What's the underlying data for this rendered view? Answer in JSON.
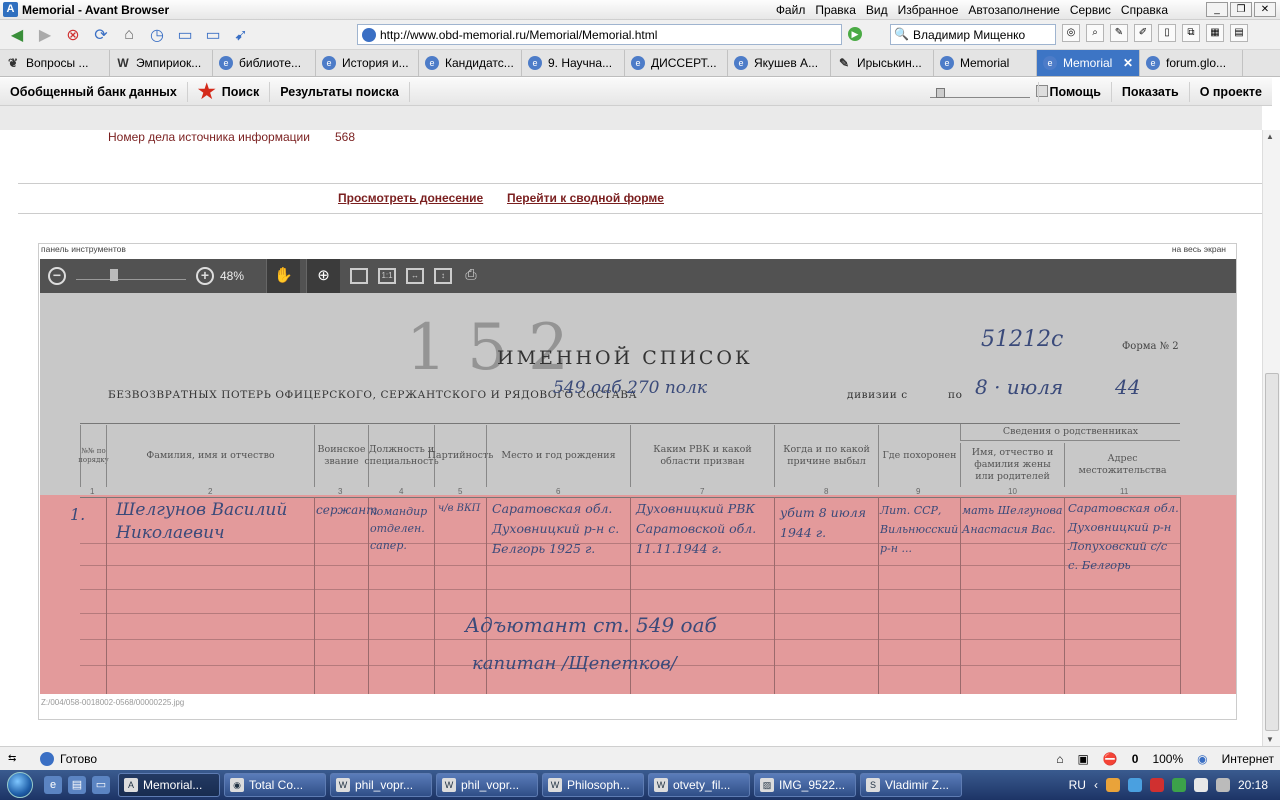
{
  "window": {
    "title": "Memorial - Avant Browser"
  },
  "menu": [
    "Файл",
    "Правка",
    "Вид",
    "Избранное",
    "Автозаполнение",
    "Сервис",
    "Справка"
  ],
  "address": {
    "url": "http://www.obd-memorial.ru/Memorial/Memorial.html"
  },
  "search": {
    "value": "Владимир Мищенко"
  },
  "tabs": [
    {
      "label": "Вопросы ...",
      "icon": "book-icon"
    },
    {
      "label": "Эмпириок...",
      "icon": "wikipedia-icon"
    },
    {
      "label": "библиоте...",
      "icon": "globe-icon"
    },
    {
      "label": "История и...",
      "icon": "globe-icon"
    },
    {
      "label": "Кандидатс...",
      "icon": "globe-icon"
    },
    {
      "label": "9. Научна...",
      "icon": "globe-icon"
    },
    {
      "label": "ДИССЕРТ...",
      "icon": "globe-icon"
    },
    {
      "label": "Якушев А...",
      "icon": "globe-icon"
    },
    {
      "label": "Ирыськин...",
      "icon": "pencil-icon"
    },
    {
      "label": "Memorial",
      "icon": "globe-icon"
    },
    {
      "label": "Memorial",
      "icon": "globe-icon",
      "active": true
    },
    {
      "label": "forum.glo...",
      "icon": "globe-icon"
    }
  ],
  "site_nav": {
    "bank": "Обобщенный банк данных",
    "search": "Поиск",
    "results": "Результаты поиска",
    "help": "Помощь",
    "show": "Показать",
    "about": "О проекте"
  },
  "record": {
    "case_label": "Номер дела источника информации",
    "case_value": "568",
    "link_view": "Просмотреть донесение",
    "link_summary": "Перейти к сводной форме"
  },
  "viewer": {
    "panel_label": "панель инструментов",
    "fullscreen_label": "на весь экран",
    "zoom": "48%",
    "file_path": "Z:/004/058-0018002-0568/00000225.jpg"
  },
  "document": {
    "title": "ИМЕННОЙ СПИСОК",
    "subtitle": "БЕЗВОЗВРАТНЫХ ПОТЕРЬ ОФИЦЕРСКОГО, СЕРЖАНТСКОГО И РЯДОВОГО СОСТАВА",
    "form_number": "Форма № 2",
    "division_label": "дивизии с",
    "by_label": "по",
    "doc_number": "51212с",
    "unit_hw": "549 оаб  270 полк",
    "date_hw": "8 · июля",
    "year_hw": "44",
    "columns": [
      {
        "n": "1",
        "label": "№№ по порядку"
      },
      {
        "n": "2",
        "label": "Фамилия, имя и отчество"
      },
      {
        "n": "3",
        "label": "Воинское звание"
      },
      {
        "n": "4",
        "label": "Должность и специальность"
      },
      {
        "n": "5",
        "label": "Партийность"
      },
      {
        "n": "6",
        "label": "Место и год рождения"
      },
      {
        "n": "7",
        "label": "Каким РВК и какой области призван"
      },
      {
        "n": "8",
        "label": "Когда и по какой причине выбыл"
      },
      {
        "n": "9",
        "label": "Где похоронен"
      },
      {
        "n": "10",
        "label": "Имя, отчество и фамилия жены или родителей"
      },
      {
        "n": "11",
        "label": "Адрес местожительства"
      }
    ],
    "relatives_header": "Сведения о родственниках",
    "row": {
      "num": "1.",
      "name": "Шелгунов Василий Николаевич",
      "rank": "сержант",
      "position": "командир отделен. сапер.",
      "party": "ч/в ВКП",
      "birth": "Саратовская обл. Духовницкий р-н с. Белгорь 1925 г.",
      "rvk": "Духовницкий РВК Саратовской обл. 11.11.1944 г.",
      "reason": "убит 8 июля 1944 г.",
      "buried": "Лит. ССР, Вильнюсский р-н ...",
      "relatives": "мать Шелгунова Анастасия Вас.",
      "address": "Саратовская обл. Духовницкий р-н Лопуховский с/с с. Белгорь"
    },
    "signature_1": "Адъютант ст. 549 оаб",
    "signature_2": "капитан  /Щепетков/"
  },
  "status": {
    "text": "Готово",
    "count": "0",
    "zoom": "100%",
    "zone": "Интернет"
  },
  "taskbar": {
    "items": [
      {
        "label": "Memorial...",
        "active": true
      },
      {
        "label": "Total Co..."
      },
      {
        "label": "phil_vopr..."
      },
      {
        "label": "phil_vopr..."
      },
      {
        "label": "Philosoph..."
      },
      {
        "label": "otvety_fil..."
      },
      {
        "label": "IMG_9522..."
      },
      {
        "label": "Vladimir Z..."
      }
    ],
    "lang": "RU",
    "clock": "20:18"
  },
  "colors": {
    "pink_band": "#e39a9b",
    "link": "#7a1f1f",
    "active_tab": "#3d75c5"
  }
}
